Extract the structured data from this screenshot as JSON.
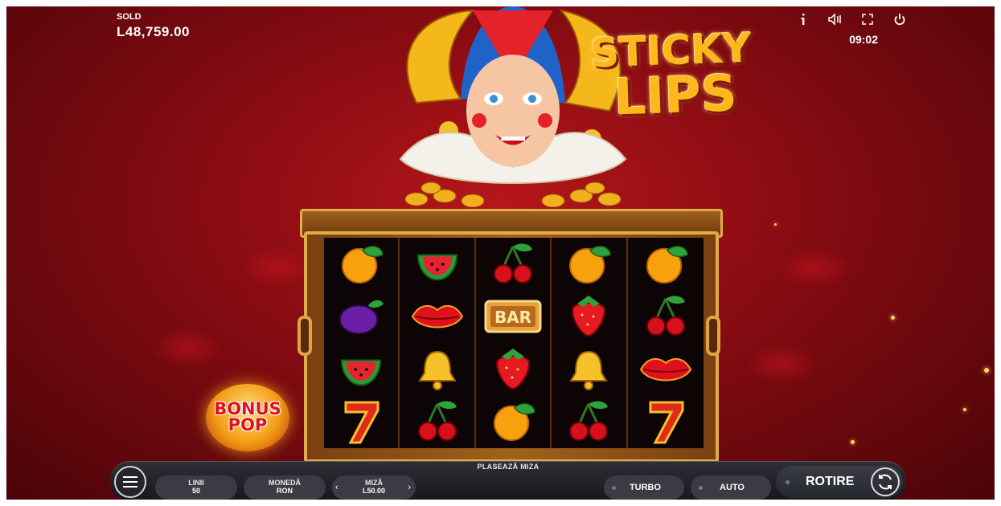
{
  "hud": {
    "balance_label": "SOLD",
    "balance_value": "L48,759.00",
    "clock": "09:02",
    "icons": [
      "info-icon",
      "sound-icon",
      "fullscreen-icon",
      "power-icon"
    ]
  },
  "title": {
    "line1": "STICKY",
    "line2": "LIPS"
  },
  "badge": {
    "line1": "BONUS",
    "line2": "POP"
  },
  "reels": [
    [
      "orange",
      "plum",
      "watermelon",
      "seven"
    ],
    [
      "watermelon",
      "lips",
      "bell",
      "cherry"
    ],
    [
      "cherry",
      "bar",
      "strawberry",
      "orange"
    ],
    [
      "orange",
      "strawberry",
      "bell",
      "cherry"
    ],
    [
      "orange",
      "cherry",
      "lips",
      "seven"
    ]
  ],
  "bar_label": "BAR",
  "bottom_bar": {
    "place_bet": "PLASEAZĂ MIZA",
    "lines_label": "LINII",
    "lines_value": "50",
    "currency_label": "MONEDĂ",
    "currency_value": "RON",
    "bet_label": "MIZĂ",
    "bet_value": "L50.00",
    "bet_prev": "‹",
    "bet_next": "›",
    "turbo": "TURBO",
    "auto": "AUTO",
    "spin": "ROTIRE"
  },
  "colors": {
    "background": "#8a0c12",
    "gold": "#e2ab4a",
    "title": "#ffb81c",
    "bar": "#24252b"
  }
}
